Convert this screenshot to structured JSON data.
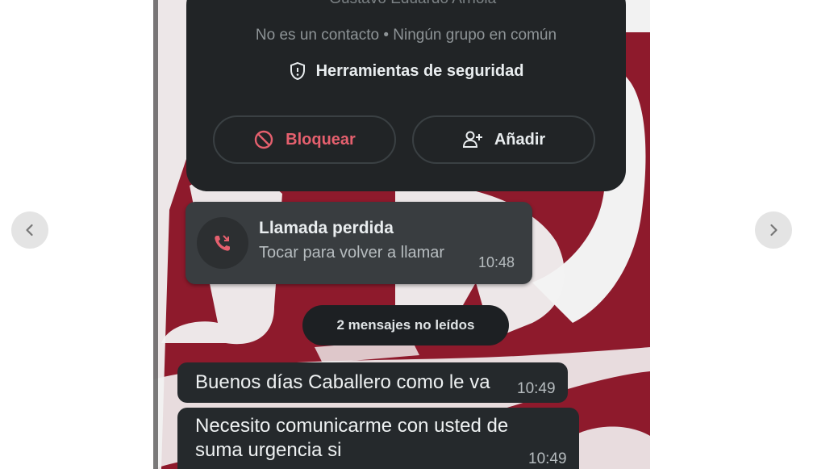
{
  "gallery": {
    "prev_label": "‹",
    "next_label": "›",
    "prev_icon": "chevron-left-icon",
    "next_icon": "chevron-right-icon"
  },
  "contact_card": {
    "name_line": "~ Gustavo Eduardo Arriola",
    "contact_status": "No es un contacto • Ningún grupo en común",
    "safety_tools_label": "Herramientas de seguridad",
    "safety_icon": "shield-icon",
    "block_label": "Bloquear",
    "block_icon": "block-icon",
    "add_label": "Añadir",
    "add_icon": "add-person-icon"
  },
  "missed_call": {
    "title": "Llamada perdida",
    "subtitle": "Tocar para volver a llamar",
    "time": "10:48",
    "icon": "missed-call-icon"
  },
  "unread_banner": "2 mensajes no leídos",
  "messages": [
    {
      "text": "Buenos días Caballero como le va",
      "time": "10:49"
    },
    {
      "text": "Necesito comunicarme con usted de suma urgencia si",
      "time": "10:49"
    }
  ],
  "colors": {
    "wallpaper": "#8e1a2c",
    "card": "#212426",
    "bubble": "#25292c",
    "block_red": "#e5606e"
  }
}
